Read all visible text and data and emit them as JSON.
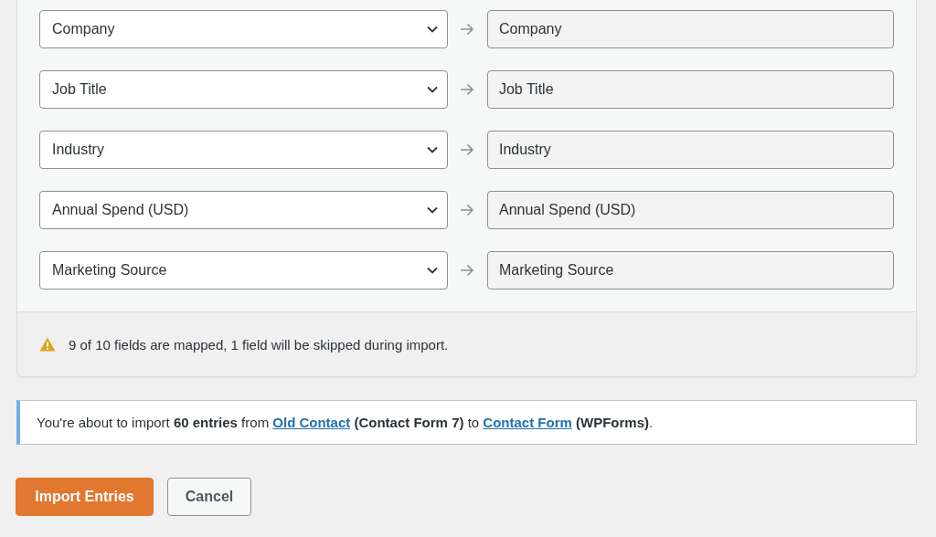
{
  "mappings": [
    {
      "source": "Company",
      "target": "Company"
    },
    {
      "source": "Job Title",
      "target": "Job Title"
    },
    {
      "source": "Industry",
      "target": "Industry"
    },
    {
      "source": "Annual Spend (USD)",
      "target": "Annual Spend (USD)"
    },
    {
      "source": "Marketing Source",
      "target": "Marketing Source"
    }
  ],
  "footer_warning": "9 of 10 fields are mapped, 1 field will be skipped during import.",
  "notice": {
    "parts": [
      {
        "kind": "text",
        "text": "You're about to import "
      },
      {
        "kind": "bold",
        "text": "60 entries"
      },
      {
        "kind": "text",
        "text": " from "
      },
      {
        "kind": "link",
        "text": "Old Contact"
      },
      {
        "kind": "bold",
        "text": " (Contact Form 7)"
      },
      {
        "kind": "text",
        "text": " to "
      },
      {
        "kind": "link",
        "text": "Contact Form"
      },
      {
        "kind": "bold",
        "text": " (WPForms)"
      },
      {
        "kind": "text",
        "text": "."
      }
    ]
  },
  "buttons": [
    {
      "kind": "primary",
      "label": "Import Entries"
    },
    {
      "kind": "secondary",
      "label": "Cancel"
    }
  ]
}
